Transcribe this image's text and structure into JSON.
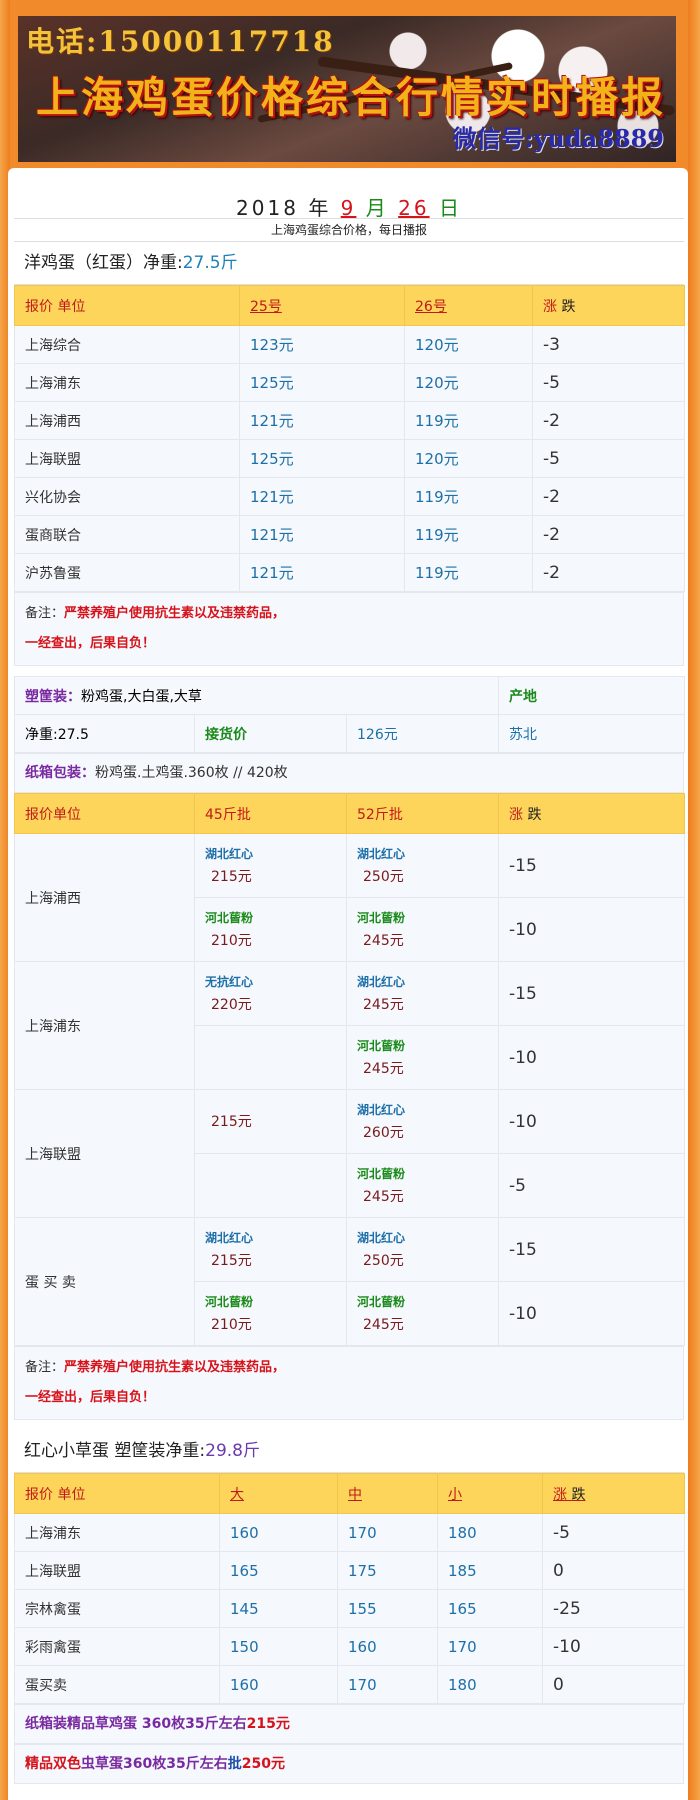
{
  "banner": {
    "phone": "电话:15000117718",
    "title": "上海鸡蛋价格综合行情实时播报",
    "wechat": "微信号:yuda8889"
  },
  "header": {
    "year": "2018",
    "year_unit": "年",
    "month": "9",
    "month_unit": "月",
    "day": "26",
    "day_unit": "日",
    "subtitle": "上海鸡蛋综合价格，每日播报"
  },
  "section1": {
    "title_prefix": "洋鸡蛋（红蛋）净重:",
    "title_weight": "27.5斤",
    "head": [
      "报价 单位",
      "25号",
      "26号",
      "涨",
      "跌"
    ],
    "rows": [
      [
        "上海综合",
        "123元",
        "120元",
        "-3"
      ],
      [
        "上海浦东",
        "125元",
        "120元",
        "-5"
      ],
      [
        "上海浦西",
        "121元",
        "119元",
        "-2"
      ],
      [
        "上海联盟",
        "125元",
        "120元",
        "-5"
      ],
      [
        "兴化协会",
        "121元",
        "119元",
        "-2"
      ],
      [
        "蛋商联合",
        "121元",
        "119元",
        "-2"
      ],
      [
        "沪苏鲁蛋",
        "121元",
        "119元",
        "-2"
      ]
    ],
    "note_label": "备注：",
    "note_red1": "严禁养殖户使用抗生素以及违禁药品，",
    "note_red2": "一经查出，后果自负！"
  },
  "section2": {
    "basket_label": "塑筐装：",
    "basket_text": "粉鸡蛋,大白蛋,大草",
    "origin_label": "产地",
    "weight": "净重:27.5",
    "pickup_label": "接货价",
    "pickup_price": "126元",
    "origin": "苏北",
    "carton_label": "纸箱包装：",
    "carton_text": "粉鸡蛋.土鸡蛋.360枚 // 420枚",
    "head": [
      "报价单位",
      "45斤批",
      "52斤批",
      "涨",
      "跌"
    ],
    "groups": [
      {
        "name": "上海浦西",
        "rows": [
          {
            "a_tag": "湖北红心",
            "a_price": "215元",
            "b_tag": "湖北红心",
            "b_price": "250元",
            "chg": "-15"
          },
          {
            "a_tag": "河北蒈粉",
            "a_price": "210元",
            "b_tag": "河北蒈粉",
            "b_price": "245元",
            "chg": "-10"
          }
        ]
      },
      {
        "name": "上海浦东",
        "rows": [
          {
            "a_tag": "无抗红心",
            "a_price": "220元",
            "b_tag": "湖北红心",
            "b_price": "245元",
            "chg": "-15"
          },
          {
            "a_tag": "",
            "a_price": "",
            "b_tag": "河北蒈粉",
            "b_price": "245元",
            "chg": "-10"
          }
        ]
      },
      {
        "name": "上海联盟",
        "rows": [
          {
            "a_tag": "",
            "a_price": "215元",
            "b_tag": "湖北红心",
            "b_price": "260元",
            "chg": "-10"
          },
          {
            "a_tag": "",
            "a_price": "",
            "b_tag": "河北蒈粉",
            "b_price": "245元",
            "chg": "-5"
          }
        ]
      },
      {
        "name": "蛋 买 卖",
        "rows": [
          {
            "a_tag": "湖北红心",
            "a_price": "215元",
            "b_tag": "湖北红心",
            "b_price": "250元",
            "chg": "-15"
          },
          {
            "a_tag": "河北蒈粉",
            "a_price": "210元",
            "b_tag": "河北蒈粉",
            "b_price": "245元",
            "chg": "-10"
          }
        ]
      }
    ],
    "note_label": "备注：",
    "note_red1": "严禁养殖户使用抗生素以及违禁药品，",
    "note_red2": "一经查出，后果自负！"
  },
  "section3": {
    "title_prefix": "红心小草蛋 塑筐装净重:",
    "title_weight": "29.8斤",
    "head": [
      "报价 单位",
      "大",
      "中",
      "小",
      "涨",
      "跌"
    ],
    "rows": [
      [
        "上海浦东",
        "160",
        "170",
        "180",
        "-5"
      ],
      [
        "上海联盟",
        "165",
        "175",
        "185",
        "0"
      ],
      [
        "宗林禽蛋",
        "145",
        "155",
        "165",
        "-25"
      ],
      [
        "彩雨禽蛋",
        "150",
        "160",
        "170",
        "-10"
      ],
      [
        "蛋买卖",
        "160",
        "170",
        "180",
        "0"
      ]
    ],
    "line1_text": "纸箱装精品草鸡蛋 360枚35斤左右",
    "line1_price": "215元",
    "line2_red": "精品双色",
    "line2_text": "虫草蛋360枚35斤左右",
    "line2_bold": "批",
    "line2_price": "250元"
  }
}
